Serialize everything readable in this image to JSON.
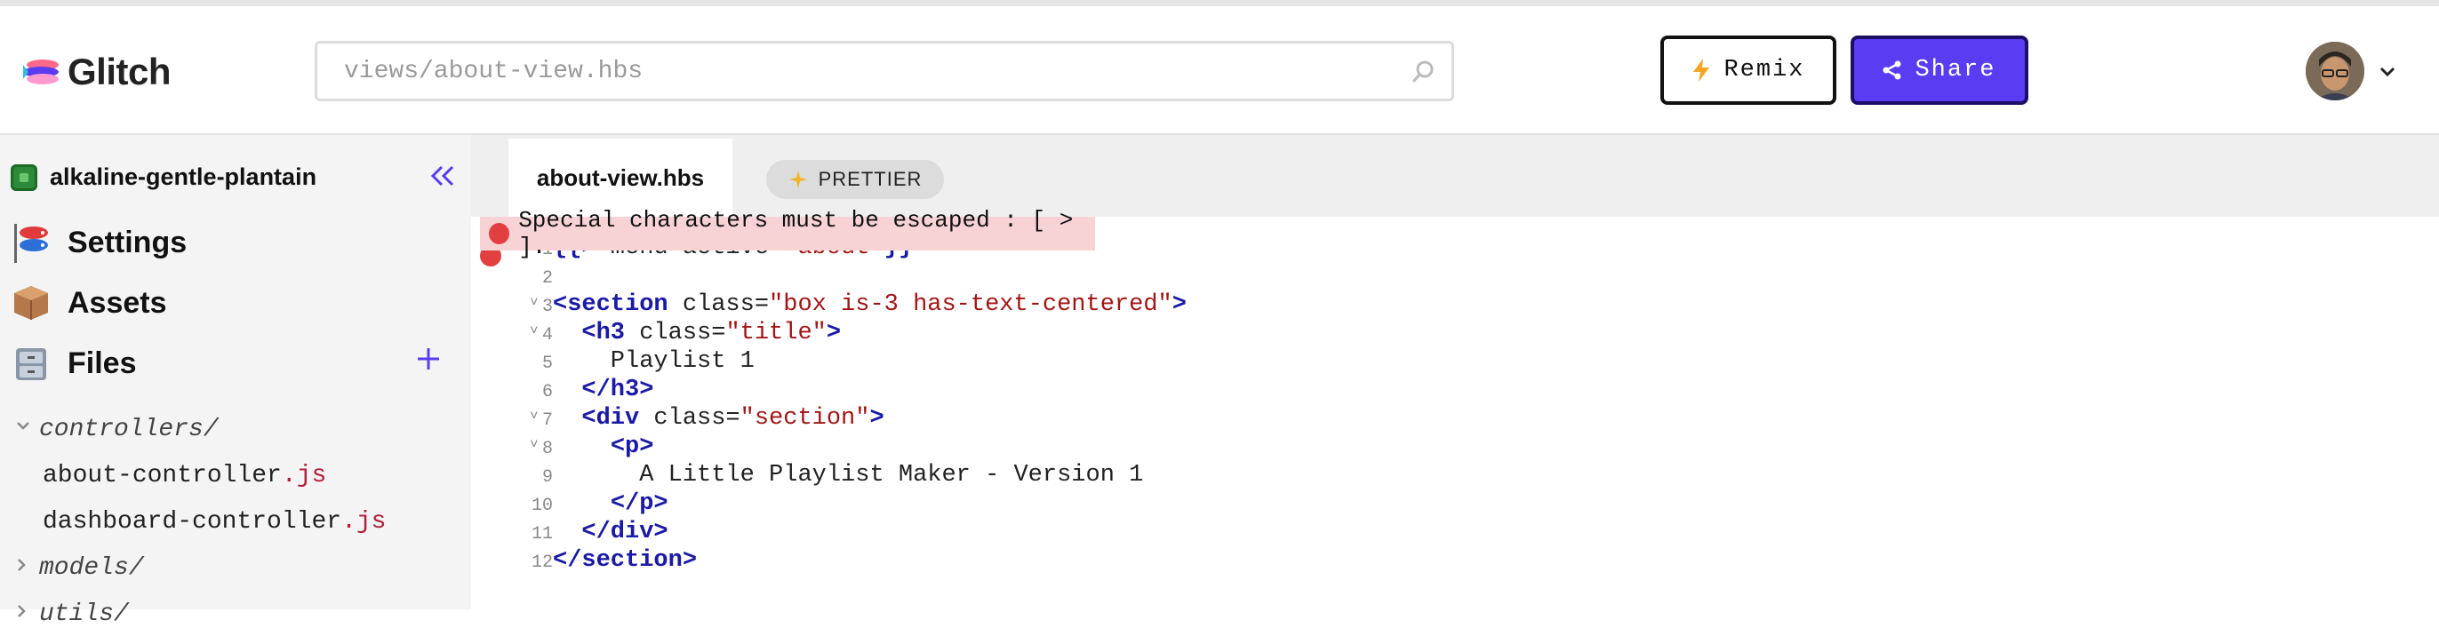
{
  "header": {
    "logo_text": "Glitch",
    "search_value": "views/about-view.hbs",
    "remix_label": "Remix",
    "share_label": "Share"
  },
  "sidebar": {
    "project_name": "alkaline-gentle-plantain",
    "nav": [
      {
        "label": "Settings",
        "icon": "koi-fish-icon"
      },
      {
        "label": "Assets",
        "icon": "package-icon"
      },
      {
        "label": "Files",
        "icon": "file-cabinet-icon"
      }
    ],
    "tree": [
      {
        "name": "controllers/",
        "type": "folder",
        "expanded": true
      },
      {
        "name": "about-controller",
        "ext": ".js",
        "type": "file"
      },
      {
        "name": "dashboard-controller",
        "ext": ".js",
        "type": "file"
      },
      {
        "name": "models/",
        "type": "folder",
        "expanded": false
      },
      {
        "name": "utils/",
        "type": "folder",
        "expanded": false
      }
    ]
  },
  "tabs": {
    "active": "about-view.hbs",
    "prettier_label": "PRETTIER"
  },
  "editor": {
    "error_message": "Special characters must be escaped : [ > ].",
    "lines": [
      {
        "n": "1",
        "text": "{{> menu active=\"about\"}}"
      },
      {
        "n": "2",
        "text": ""
      },
      {
        "n": "3",
        "text": "<section class=\"box is-3 has-text-centered\">"
      },
      {
        "n": "4",
        "text": "  <h3 class=\"title\">"
      },
      {
        "n": "5",
        "text": "    Playlist 1"
      },
      {
        "n": "6",
        "text": "  </h3>"
      },
      {
        "n": "7",
        "text": "  <div class=\"section\">"
      },
      {
        "n": "8",
        "text": "    <p>"
      },
      {
        "n": "9",
        "text": "      A Little Playlist Maker - Version 1"
      },
      {
        "n": "10",
        "text": "    </p>"
      },
      {
        "n": "11",
        "text": "  </div>"
      },
      {
        "n": "12",
        "text": "</section>"
      }
    ]
  },
  "colors": {
    "share_bg": "#5a3cf3",
    "error_bg": "#f8d3d6",
    "tag_color": "#1a1aa6",
    "string_color": "#a31515"
  }
}
